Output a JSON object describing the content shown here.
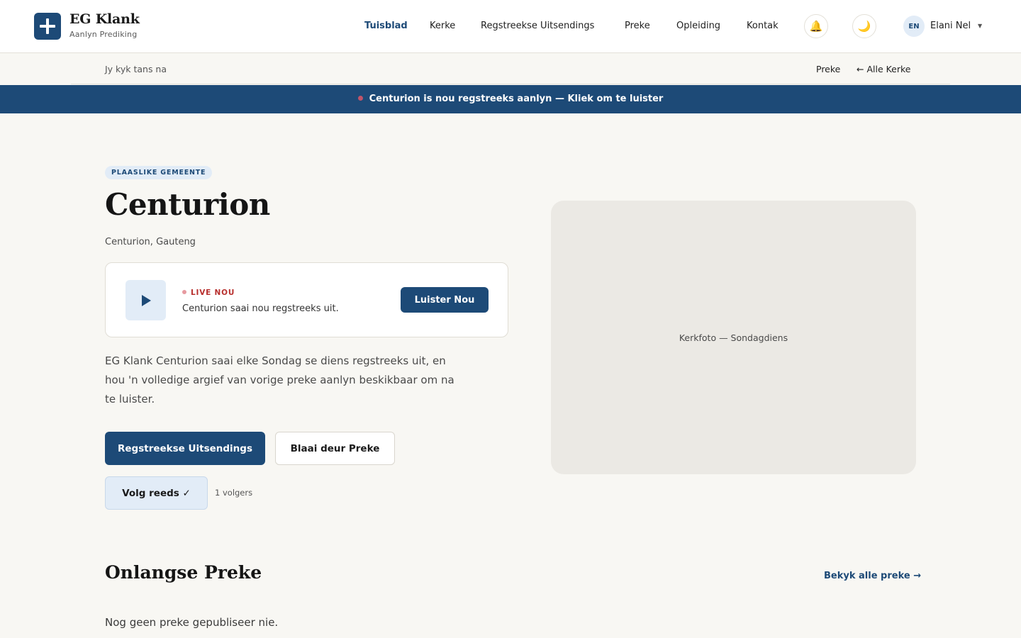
{
  "brand": {
    "name": "EG Klank",
    "tagline": "Aanlyn Prediking"
  },
  "nav": {
    "items": [
      {
        "label": "Tuisblad",
        "active": true
      },
      {
        "label": "Kerke"
      },
      {
        "label": "Regstreekse Uitsendings"
      },
      {
        "label": "Preke"
      },
      {
        "label": "Opleiding"
      },
      {
        "label": "Kontak"
      }
    ],
    "notification_icon": "bell-icon",
    "theme_icon": "moon-icon",
    "language": "EN",
    "user_name": "Elani Nel"
  },
  "breadcrumb": {
    "left": "Jy kyk tans na",
    "links": [
      "Preke",
      "← Alle Kerke"
    ]
  },
  "live_banner": {
    "text": "Centurion is nou regstreeks aanlyn — Kliek om te luister"
  },
  "hero": {
    "badge": "PLAASLIKE GEMEENTE",
    "title": "Centurion",
    "location": "Centurion, Gauteng",
    "live_card": {
      "label": "LIVE NOU",
      "text": "Centurion saai nou regstreeks uit.",
      "button": "Luister Nou"
    },
    "description": "EG Klank Centurion saai elke Sondag se diens regstreeks uit, en hou 'n volledige argief van vorige preke aanlyn beskikbaar om na te luister.",
    "buttons": {
      "primary": "Regstreekse Uitsendings",
      "secondary": "Blaai deur Preke",
      "follow": "Volg reeds ✓"
    },
    "followers": "1 volgers",
    "photo_caption": "Kerkfoto — Sondagdiens"
  },
  "recent": {
    "title": "Onlangse Preke",
    "view_all": "Bekyk alle preke →",
    "empty": "Nog geen preke gepubliseer nie."
  },
  "colors": {
    "primary": "#1d4a77",
    "live_red": "#b8302e",
    "background": "#f8f7f3",
    "accent_light": "#e2ecf7"
  }
}
